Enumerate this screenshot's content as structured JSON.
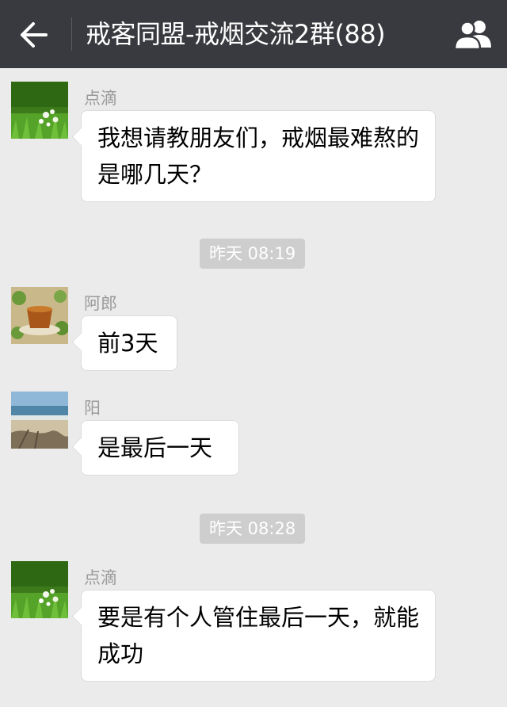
{
  "header": {
    "title": "戒客同盟-戒烟交流2群(88)",
    "back_icon": "back-arrow-icon",
    "members_icon": "group-members-icon"
  },
  "messages": [
    {
      "sender": "点滴",
      "text": "我想请教朋友们，戒烟最难熬的是哪几天？",
      "avatar": "grass-flowers-avatar"
    },
    {
      "sender": "阿郎",
      "text": "前3天",
      "avatar": "tea-cup-avatar"
    },
    {
      "sender": "阳",
      "text": "是最后一天",
      "avatar": "beach-avatar"
    },
    {
      "sender": "点滴",
      "text": "要是有个人管住最后一天，就能成功",
      "avatar": "grass-flowers-avatar"
    }
  ],
  "timestamps": [
    "昨天 08:19",
    "昨天 08:28"
  ],
  "colors": {
    "topbar": "#393a3f",
    "background": "#ebebeb",
    "bubble": "#ffffff",
    "timestamp_bg": "#cecece"
  }
}
